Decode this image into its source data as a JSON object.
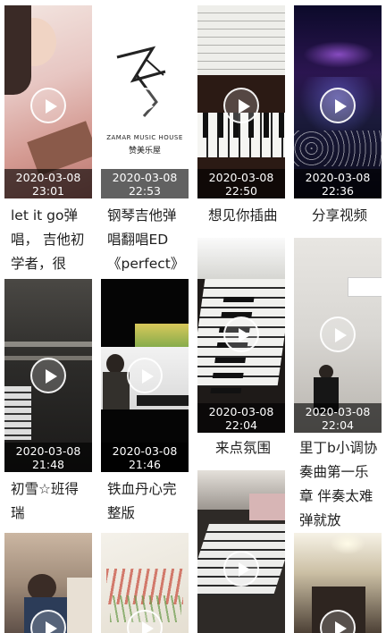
{
  "cards": [
    {
      "timestamp_date": "2020-03-08",
      "timestamp_time": "23:01",
      "title": "let it go弹唱， 吉他初学者，很"
    },
    {
      "timestamp_date": "2020-03-08",
      "timestamp_time": "22:53",
      "title": "钢琴吉他弹唱翻唱ED《perfect》",
      "logo_en": "ZAMAR MUSIC HOUSE",
      "logo_cn": "赞美乐屋"
    },
    {
      "timestamp_date": "2020-03-08",
      "timestamp_time": "22:50",
      "title": "想见你插曲"
    },
    {
      "timestamp_date": "2020-03-08",
      "timestamp_time": "22:36",
      "title": "分享视频"
    },
    {
      "timestamp_date": "2020-03-08",
      "timestamp_time": "21:48",
      "title": "初雪☆班得瑞"
    },
    {
      "timestamp_date": "2020-03-08",
      "timestamp_time": "21:46",
      "title": "铁血丹心完整版"
    },
    {
      "timestamp_date": "2020-03-08",
      "timestamp_time": "22:04",
      "title": "来点氛围"
    },
    {
      "timestamp_date": "2020-03-08",
      "timestamp_time": "22:04",
      "title": "里丁b小调协奏曲第一乐章 伴奏太难弹就放"
    },
    {
      "timestamp_date": "",
      "timestamp_time": "",
      "title": ""
    },
    {
      "timestamp_date": "",
      "timestamp_time": "",
      "title": ""
    },
    {
      "timestamp_date": "",
      "timestamp_time": "",
      "title": ""
    },
    {
      "timestamp_date": "",
      "timestamp_time": "",
      "title": ""
    }
  ]
}
